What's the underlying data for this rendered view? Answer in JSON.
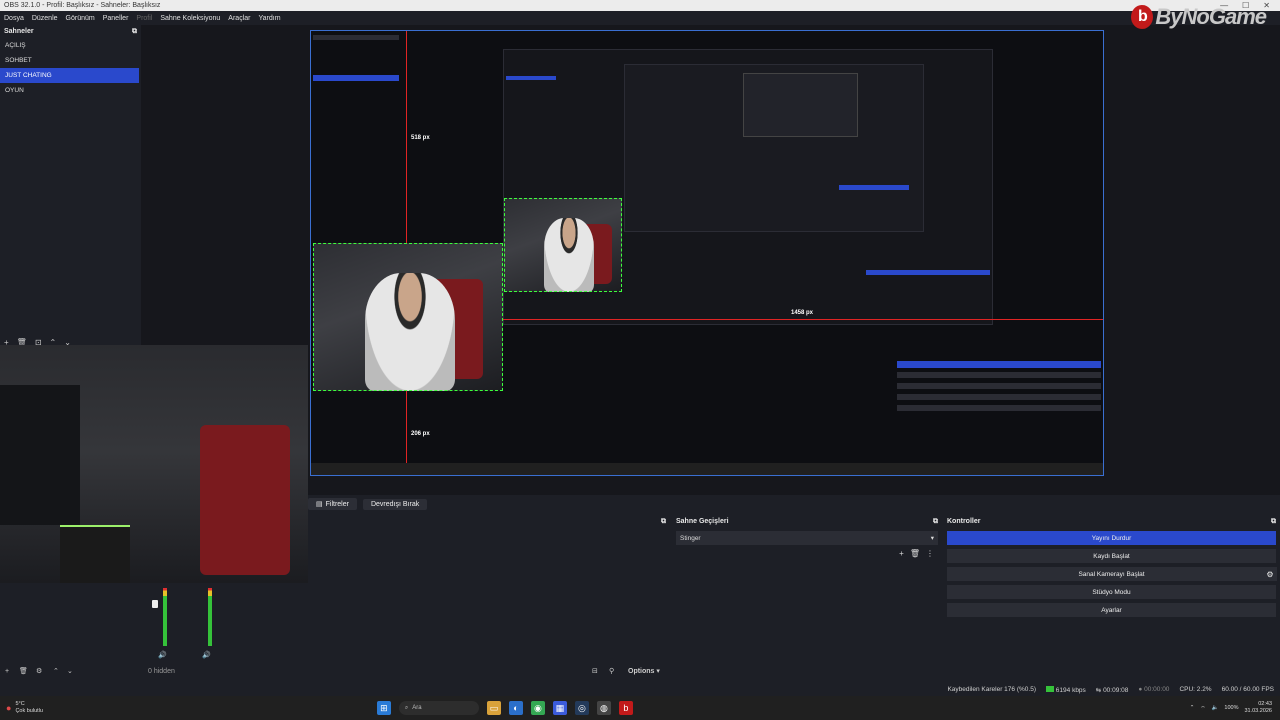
{
  "window": {
    "title": "OBS 32.1.0 - Profil: Başlıksız - Sahneler: Başlıksız",
    "controls": [
      "—",
      "☐",
      "✕"
    ]
  },
  "menu": {
    "items": [
      "Dosya",
      "Düzenle",
      "Görünüm",
      "Paneller",
      "Profil",
      "Sahne Koleksiyonu",
      "Araçlar",
      "Yardım"
    ]
  },
  "scenes": {
    "title": "Sahneler",
    "items": [
      "AÇILIŞ",
      "SOHBET",
      "JUST CHATING",
      "OYUN"
    ],
    "active_index": 2
  },
  "watermark": {
    "text": "ByNoGame"
  },
  "preview": {
    "measure_top": "518 px",
    "measure_right": "1458 px",
    "measure_bottom": "206 px"
  },
  "sources_toolbar": {
    "filters": "Filtreler",
    "deactivate": "Devredışı Bırak"
  },
  "transitions": {
    "title": "Sahne Geçişleri",
    "selected": "Stinger"
  },
  "controls": {
    "title": "Kontroller",
    "buttons": [
      "Yayını Durdur",
      "Kaydı Başlat",
      "Sanal Kamerayı Başlat",
      "Stüdyo Modu",
      "Ayarlar"
    ]
  },
  "mixer": {
    "hidden": "0 hidden",
    "options": "Options"
  },
  "status": {
    "dropped": "Kaybedilen Kareler 176 (%0.5)",
    "bitrate": "6194 kbps",
    "stream_time": "00:09:08",
    "rec_time": "00:00:00",
    "cpu": "CPU: 2.2%",
    "fps": "60.00 / 60.00 FPS"
  },
  "taskbar": {
    "weather_temp": "5°C",
    "weather_desc": "Çok bulutlu",
    "search": "Ara",
    "time": "02:43",
    "date": "31.03.2026",
    "battery": "100%"
  },
  "colors": {
    "accent": "#2a49cc",
    "guide": "#e02424",
    "selection": "#3cff3c"
  }
}
